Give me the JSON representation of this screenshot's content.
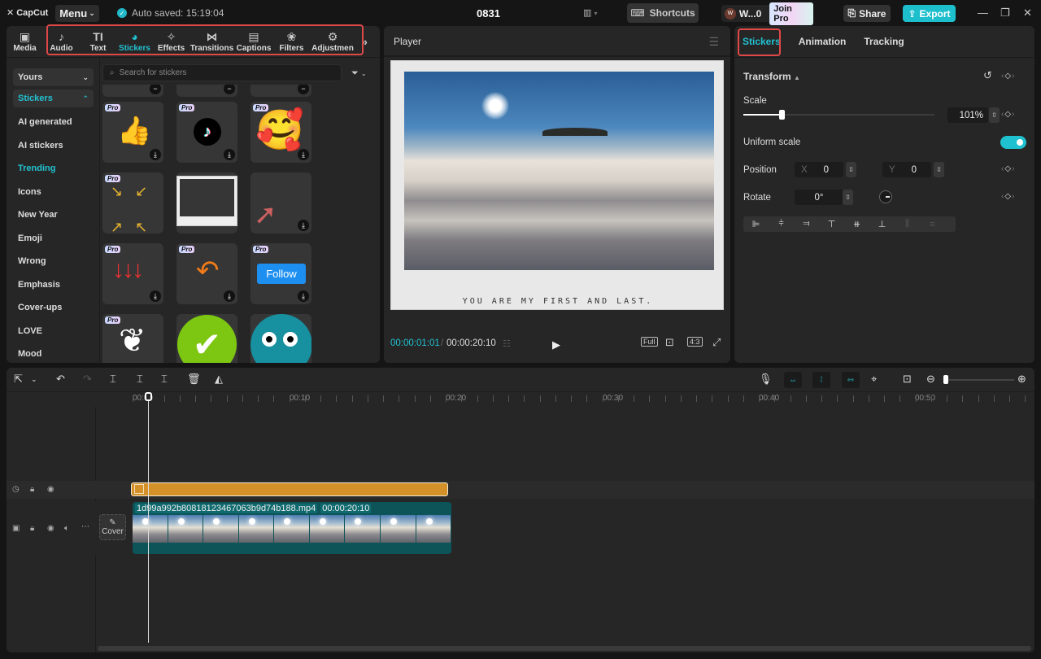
{
  "app": {
    "logo_text": "CapCut",
    "menu_label": "Menu",
    "autosave_text": "Auto saved: 15:19:04",
    "project_title": "0831",
    "shortcuts_label": "Shortcuts",
    "user_name": "W...0",
    "user_initial": "W",
    "join_pro_label": "Join Pro",
    "share_label": "Share",
    "export_label": "Export",
    "accent_color": "#1dbfcd"
  },
  "toolbar": {
    "tabs": [
      {
        "label": "Media",
        "icon": "media-icon",
        "glyph": "▣"
      },
      {
        "label": "Audio",
        "icon": "audio-icon",
        "glyph": "♪"
      },
      {
        "label": "Text",
        "icon": "text-icon",
        "glyph": "TI"
      },
      {
        "label": "Stickers",
        "icon": "stickers-icon",
        "glyph": "◕",
        "active": true
      },
      {
        "label": "Effects",
        "icon": "effects-icon",
        "glyph": "✧"
      },
      {
        "label": "Transitions",
        "icon": "transitions-icon",
        "glyph": "⋈"
      },
      {
        "label": "Captions",
        "icon": "captions-icon",
        "glyph": "▤"
      },
      {
        "label": "Filters",
        "icon": "filters-icon",
        "glyph": "❀"
      },
      {
        "label": "Adjustmen",
        "icon": "adjustment-icon",
        "glyph": "⚙"
      }
    ],
    "more_glyph": "»"
  },
  "sticker_panel": {
    "categories": [
      {
        "label": "Yours",
        "type": "dropdown",
        "chevron": "⌄"
      },
      {
        "label": "Stickers",
        "type": "dropdown-open",
        "chevron": "⌃"
      },
      {
        "label": "AI generated"
      },
      {
        "label": "AI stickers"
      },
      {
        "label": "Trending",
        "active": true
      },
      {
        "label": "Icons"
      },
      {
        "label": "New Year"
      },
      {
        "label": "Emoji"
      },
      {
        "label": "Wrong"
      },
      {
        "label": "Emphasis"
      },
      {
        "label": "Cover-ups"
      },
      {
        "label": "LOVE"
      },
      {
        "label": "Mood"
      }
    ],
    "search_placeholder": "Search for stickers",
    "pro_badge": "Pro",
    "download_glyph": "⤓",
    "stickers": [
      {
        "name": "thumbs-up-sticker",
        "pro": true,
        "glyph": "👍"
      },
      {
        "name": "tiktok-logo-sticker",
        "pro": true,
        "glyph": "♪"
      },
      {
        "name": "smiling-hearts-emoji-sticker",
        "pro": true,
        "glyph": "🥰"
      },
      {
        "name": "yellow-arrows-sticker",
        "pro": true,
        "glyph": "↘ ↙"
      },
      {
        "name": "polaroid-frame-sticker",
        "pro": false,
        "glyph": ""
      },
      {
        "name": "red-3d-arrow-sticker",
        "pro": false,
        "glyph": "➚"
      },
      {
        "name": "red-down-arrows-sticker",
        "pro": true,
        "glyph": "↓↓↓"
      },
      {
        "name": "orange-curved-arrow-sticker",
        "pro": true,
        "glyph": "↶"
      },
      {
        "name": "follow-button-sticker",
        "pro": true,
        "glyph": "Follow"
      },
      {
        "name": "plant-pot-sticker",
        "pro": true,
        "glyph": "❦"
      },
      {
        "name": "green-check-sticker",
        "pro": false,
        "glyph": "✔"
      },
      {
        "name": "teal-face-sticker",
        "pro": false,
        "glyph": "••"
      }
    ]
  },
  "player": {
    "title": "Player",
    "caption": "YOU ARE MY FIRST AND LAST.",
    "current_time": "00:00:01:01",
    "time_separator": "/",
    "total_time": "00:00:20:10",
    "full_label": "Full",
    "ratio_label": "4:3"
  },
  "inspector": {
    "tabs": [
      "Stickers",
      "Animation",
      "Tracking"
    ],
    "active_tab": "Stickers",
    "section_title": "Transform",
    "scale_label": "Scale",
    "scale_value": "101%",
    "scale_fraction": 0.2,
    "uniform_scale_label": "Uniform scale",
    "uniform_scale_on": true,
    "position_label": "Position",
    "pos_x_label": "X",
    "pos_x": "0",
    "pos_y_label": "Y",
    "pos_y": "0",
    "rotate_label": "Rotate",
    "rotate_value": "0°"
  },
  "timeline": {
    "ruler_labels": [
      "00:00",
      "00:10",
      "00:20",
      "00:30",
      "00:40",
      "00:50"
    ],
    "clip_name": "1d99a992b80818123467063b9d74b188.mp4",
    "clip_duration": "00:00:20:10",
    "cover_label": "Cover",
    "sticker_clip_color": "#d4912a",
    "video_clip_color": "#0d5458"
  }
}
